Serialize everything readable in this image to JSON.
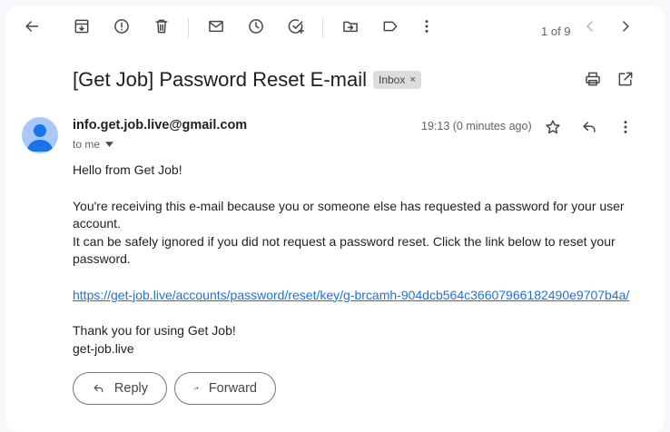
{
  "toolbar": {
    "pager": "1 of 9",
    "icons": [
      "back-arrow-icon",
      "archive-icon",
      "report-spam-icon",
      "delete-icon",
      "mark-unread-icon",
      "snooze-icon",
      "add-to-tasks-icon",
      "move-to-icon",
      "label-icon",
      "more-vert-icon",
      "prev-icon",
      "next-icon"
    ]
  },
  "message": {
    "subject": "[Get Job] Password Reset E-mail",
    "label": "Inbox",
    "label_close": "×",
    "sender": "info.get.job.live@gmail.com",
    "recipient": "to me",
    "time": "19:13 (0 minutes ago)",
    "body": {
      "greeting": "Hello from Get Job!",
      "para1_line1": "You're receiving this e-mail because you or someone else has requested a password for your user account.",
      "para1_line2": "It can be safely ignored if you did not request a password reset. Click the link below to reset your password.",
      "link": "https://get-job.live/accounts/password/reset/key/g-brcamh-904dcb564c36607966182490e9707b4a/",
      "thanks": "Thank you for using Get Job!",
      "signature": "get-job.live"
    }
  },
  "actions": {
    "reply": "Reply",
    "forward": "Forward"
  },
  "colors": {
    "background": "#f6f8fc",
    "link": "#1a73e8",
    "avatar": "#a8c7fa"
  }
}
